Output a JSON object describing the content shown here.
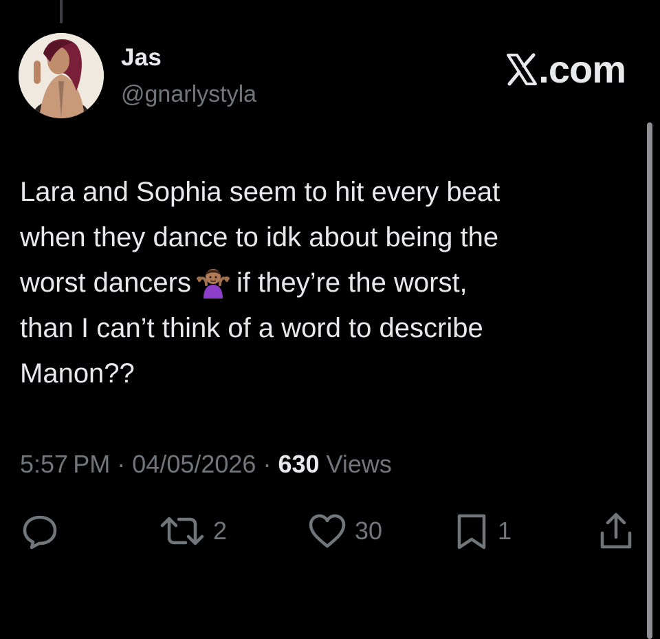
{
  "app": {
    "brand_label": ".com"
  },
  "author": {
    "display_name": "Jas",
    "handle": "@gnarlystyla"
  },
  "tweet": {
    "lines": [
      "Lara and Sophia seem to hit every beat",
      "when they dance to idk about being the",
      "worst dancers",
      "if they’re the worst,",
      "than I can’t think of a word to describe",
      "Manon??"
    ],
    "emoji": "person-shrugging-emoji"
  },
  "meta": {
    "time": "5:57 PM",
    "separator_1": " · ",
    "date": "04/05/2026",
    "separator_2": " · ",
    "views_count": "630",
    "views_label": " Views"
  },
  "actions": {
    "reply": {
      "icon": "reply-icon",
      "count": ""
    },
    "repost": {
      "icon": "repost-icon",
      "count": "2"
    },
    "like": {
      "icon": "heart-icon",
      "count": "30"
    },
    "bookmark": {
      "icon": "bookmark-icon",
      "count": "1"
    },
    "share": {
      "icon": "share-icon",
      "count": ""
    }
  },
  "colors": {
    "background": "#000000",
    "primary_text": "#e7e9ea",
    "secondary_text": "#71767b"
  }
}
